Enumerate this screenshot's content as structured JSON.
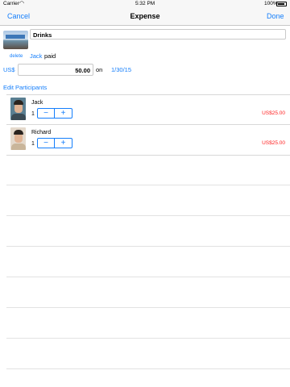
{
  "status_bar": {
    "carrier": "Carrier",
    "time": "5:32 PM",
    "battery": "100%",
    "wifi_icon": "wifi-icon"
  },
  "nav": {
    "cancel": "Cancel",
    "title": "Expense",
    "done": "Done"
  },
  "expense": {
    "name": "Drinks",
    "delete_label": "delete",
    "payer": "Jack",
    "paid_label": "paid",
    "currency": "US$",
    "amount": "50.00",
    "on_label": "on",
    "date": "1/30/15"
  },
  "edit_participants_label": "Edit Participants",
  "participants": [
    {
      "name": "Jack",
      "quantity": "1",
      "amount": "US$25.00"
    },
    {
      "name": "Richard",
      "quantity": "1",
      "amount": "US$25.00"
    }
  ],
  "stepper": {
    "minus": "−",
    "plus": "+"
  },
  "colors": {
    "accent": "#147efb",
    "amount": "#ff1f1f",
    "bar_background": "#f7f7f7"
  }
}
